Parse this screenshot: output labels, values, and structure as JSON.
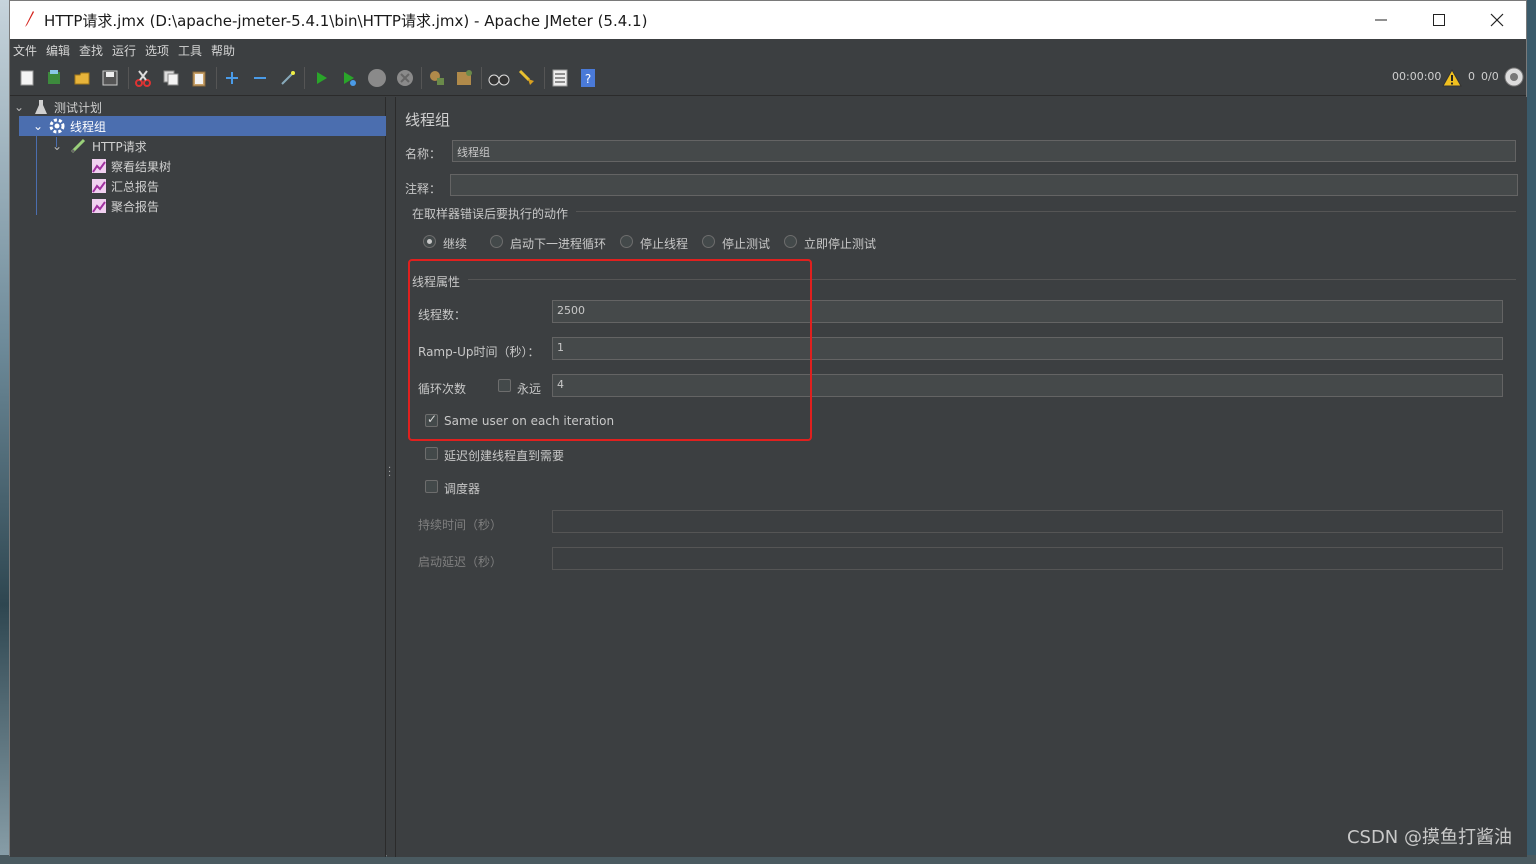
{
  "window": {
    "title": "HTTP请求.jmx (D:\\apache-jmeter-5.4.1\\bin\\HTTP请求.jmx) - Apache JMeter (5.4.1)"
  },
  "menu": [
    "文件",
    "编辑",
    "查找",
    "运行",
    "选项",
    "工具",
    "帮助"
  ],
  "toolbar": {
    "timer": "00:00:00",
    "warning_count": "0",
    "thread_ratio": "0/0"
  },
  "tree": {
    "items": [
      {
        "label": "测试计划",
        "icon": "test-plan-icon"
      },
      {
        "label": "线程组",
        "icon": "gear-icon"
      },
      {
        "label": "HTTP请求",
        "icon": "pen-icon"
      },
      {
        "label": "察看结果树",
        "icon": "graph-icon"
      },
      {
        "label": "汇总报告",
        "icon": "graph-icon"
      },
      {
        "label": "聚合报告",
        "icon": "graph-icon"
      }
    ]
  },
  "panel": {
    "heading": "线程组",
    "name_label": "名称：",
    "name_value": "线程组",
    "comment_label": "注释：",
    "comment_value": "",
    "error_action_title": "在取样器错误后要执行的动作",
    "error_actions": [
      "继续",
      "启动下一进程循环",
      "停止线程",
      "停止测试",
      "立即停止测试"
    ],
    "error_action_selected": "继续",
    "thread_props_title": "线程属性",
    "threads_label": "线程数：",
    "threads_value": "2500",
    "rampup_label": "Ramp-Up时间（秒）：",
    "rampup_value": "1",
    "loop_label": "循环次数",
    "forever_label": "永远",
    "forever_checked": false,
    "loop_value": "4",
    "same_user_label": "Same user on each iteration",
    "same_user_checked": true,
    "delay_create_label": "延迟创建线程直到需要",
    "delay_create_checked": false,
    "scheduler_label": "调度器",
    "scheduler_checked": false,
    "duration_label": "持续时间（秒）",
    "duration_value": "",
    "startup_delay_label": "启动延迟（秒）",
    "startup_delay_value": ""
  },
  "watermark": "CSDN @摸鱼打酱油",
  "colors": {
    "panel_bg": "#3c3f41",
    "selection": "#4b6eaf",
    "highlight_box": "#e0201e"
  }
}
